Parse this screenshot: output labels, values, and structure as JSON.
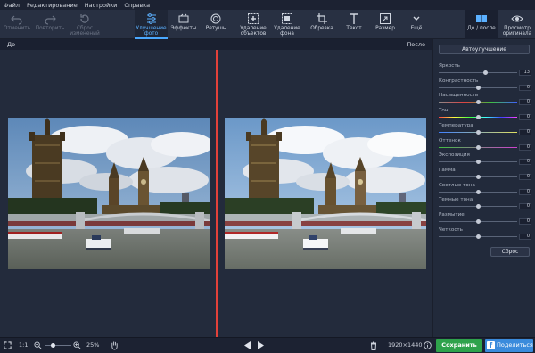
{
  "menu": [
    "Файл",
    "Редактирование",
    "Настройки",
    "Справка"
  ],
  "toolbar": {
    "undo": "Отменить",
    "redo": "Повторить",
    "reset_line1": "Сброс",
    "reset_line2": "изменений",
    "enhance_line1": "Улучшение",
    "enhance_line2": "фото",
    "effects": "Эффекты",
    "retouch": "Ретушь",
    "remove_obj_line1": "Удаление",
    "remove_obj_line2": "объектов",
    "remove_bg_line1": "Удаление",
    "remove_bg_line2": "фона",
    "crop": "Обрезка",
    "text": "Текст",
    "resize": "Размер",
    "more": "Ещё",
    "before_after": "До / после",
    "view_line1": "Просмотр",
    "view_line2": "оригинала"
  },
  "view": {
    "before": "До",
    "after": "После"
  },
  "panel": {
    "auto_button": "Автоулучшение",
    "reset_button": "Сброс",
    "sliders": [
      {
        "label": "Яркость",
        "value": "13",
        "pos": 0.6,
        "color": "#5a6478"
      },
      {
        "label": "Контрастность",
        "value": "0",
        "pos": 0.5,
        "color": "#5a6478"
      },
      {
        "label": "Насыщенность",
        "value": "0",
        "pos": 0.5,
        "color": "linear-gradient(90deg,#8a8a8a,#e04040,#40c040,#4060ff)"
      },
      {
        "label": "Тон",
        "value": "0",
        "pos": 0.5,
        "color": "linear-gradient(90deg,#ff4040,#ffff40,#40ff40,#40ffff,#4040ff,#ff40ff)"
      },
      {
        "label": "Температура",
        "value": "0",
        "pos": 0.5,
        "color": "linear-gradient(90deg,#4080ff,#e0e060)"
      },
      {
        "label": "Оттенок",
        "value": "0",
        "pos": 0.5,
        "color": "linear-gradient(90deg,#40c040,#d040d0)"
      },
      {
        "label": "Экспозиция",
        "value": "0",
        "pos": 0.5,
        "color": "#5a6478"
      },
      {
        "label": "Гамма",
        "value": "0",
        "pos": 0.5,
        "color": "#5a6478"
      },
      {
        "label": "Светлые тона",
        "value": "0",
        "pos": 0.5,
        "color": "#5a6478"
      },
      {
        "label": "Темные тона",
        "value": "0",
        "pos": 0.5,
        "color": "#5a6478"
      },
      {
        "label": "Размытие",
        "value": "0",
        "pos": 0.5,
        "color": "#5a6478"
      },
      {
        "label": "Четкость",
        "value": "0",
        "pos": 0.5,
        "color": "#5a6478"
      }
    ]
  },
  "status": {
    "ratio": "1:1",
    "zoom": "25%",
    "zoom_level": 0.3,
    "dimensions": "1920×1440",
    "save": "Сохранить",
    "share": "Поделиться"
  }
}
